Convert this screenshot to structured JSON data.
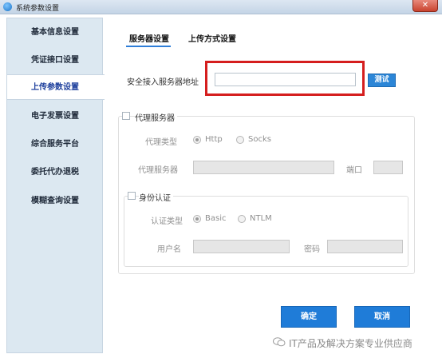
{
  "window": {
    "title": "系统参数设置",
    "close_glyph": "✕"
  },
  "sidebar": {
    "items": [
      {
        "label": "基本信息设置",
        "active": false
      },
      {
        "label": "凭证接口设置",
        "active": false
      },
      {
        "label": "上传参数设置",
        "active": true
      },
      {
        "label": "电子发票设置",
        "active": false
      },
      {
        "label": "综合服务平台",
        "active": false
      },
      {
        "label": "委托代办退税",
        "active": false
      },
      {
        "label": "模糊查询设置",
        "active": false
      }
    ]
  },
  "tabs": [
    {
      "label": "服务器设置",
      "active": true
    },
    {
      "label": "上传方式设置",
      "active": false
    }
  ],
  "server": {
    "address_label": "安全接入服务器地址",
    "address_value": "",
    "test_button": "测试"
  },
  "proxy": {
    "checkbox_label": "代理服务器",
    "checked": false,
    "type_label": "代理类型",
    "type_options": [
      "Http",
      "Socks"
    ],
    "type_selected": "Http",
    "server_label": "代理服务器",
    "server_value": "",
    "port_label": "端口",
    "port_value": ""
  },
  "auth": {
    "checkbox_label": "身份认证",
    "checked": false,
    "type_label": "认证类型",
    "type_options": [
      "Basic",
      "NTLM"
    ],
    "type_selected": "Basic",
    "username_label": "用户名",
    "username_value": "",
    "password_label": "密码",
    "password_value": ""
  },
  "actions": {
    "ok": "确定",
    "cancel": "取消"
  },
  "watermark": {
    "icon": "wechat-icon",
    "text": "IT产品及解决方案专业供应商"
  },
  "colors": {
    "accent": "#1f7cd8",
    "highlight": "#d51e1e",
    "sidebar_bg": "#dce8f1"
  }
}
